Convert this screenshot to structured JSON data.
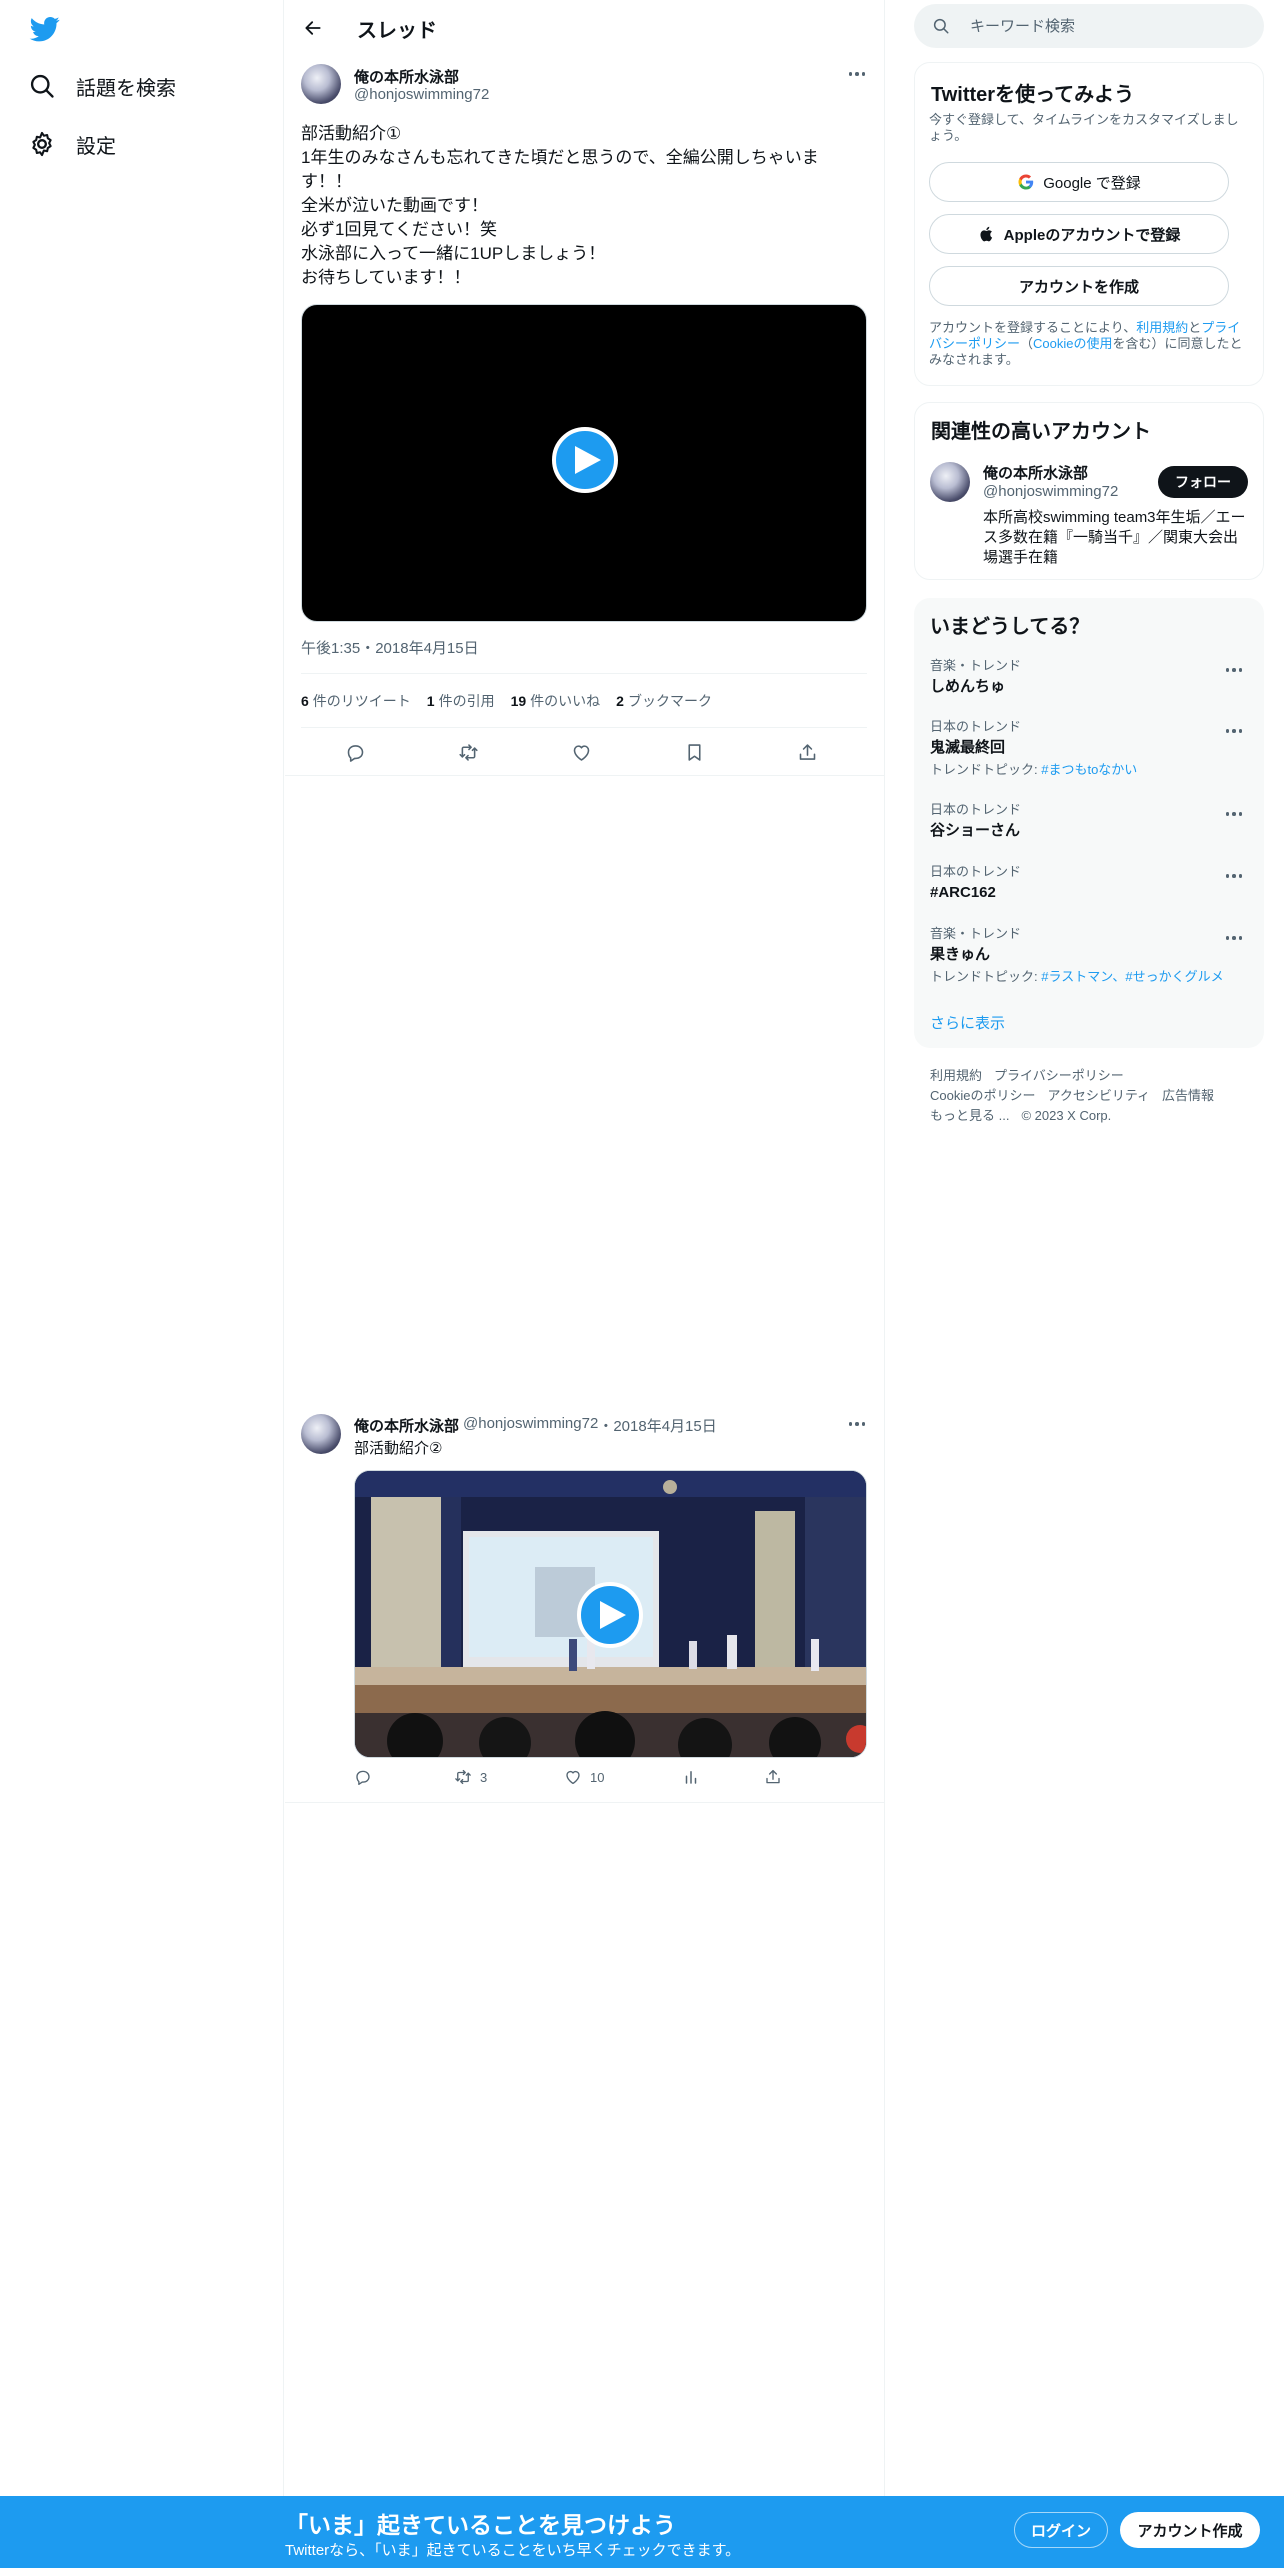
{
  "nav": {
    "explore_label": "話題を検索",
    "settings_label": "設定"
  },
  "header": {
    "title": "スレッド"
  },
  "tweet": {
    "author_name": "俺の本所水泳部",
    "author_handle": "@honjoswimming72",
    "text_lines": [
      "部活動紹介①",
      "1年生のみなさんも忘れてきた頃だと思うので、全編公開しちゃいま",
      "す！！",
      "全米が泣いた動画です！",
      "必ず1回見てください！笑",
      "水泳部に入って一緒に1UPしましょう！",
      "お待ちしています！！"
    ],
    "time": "午後1:35・2018年4月15日",
    "stats": {
      "retweets_count": "6",
      "retweets_label": "件のリツイート",
      "quotes_count": "1",
      "quotes_label": "件の引用",
      "likes_count": "19",
      "likes_label": "件のいいね",
      "bookmarks_count": "2",
      "bookmarks_label": "ブックマーク"
    }
  },
  "reply": {
    "author_name": "俺の本所水泳部",
    "author_handle": "@honjoswimming72",
    "separator": "・",
    "date": "2018年4月15日",
    "text": "部活動紹介②",
    "retweets": "3",
    "likes": "10"
  },
  "search": {
    "placeholder": "キーワード検索"
  },
  "signup_card": {
    "title": "Twitterを使ってみよう",
    "subtitle": "今すぐ登録して、タイムラインをカスタマイズしましょう。",
    "google_label": "Google で登録",
    "apple_label": "Appleのアカウントで登録",
    "create_label": "アカウントを作成",
    "legal_prefix": "アカウントを登録することにより、",
    "legal_terms": "利用規約",
    "legal_and": "と",
    "legal_privacy": "プライバシーポリシー",
    "legal_open": "（",
    "legal_cookie": "Cookieの使用",
    "legal_suffix": "を含む）に同意したとみなされます。"
  },
  "related": {
    "title": "関連性の高いアカウント",
    "name": "俺の本所水泳部",
    "handle": "@honjoswimming72",
    "follow_label": "フォロー",
    "bio": "本所高校swimming team3年生垢／エース多数在籍『一騎当千』／関東大会出場選手在籍"
  },
  "trends": {
    "title": "いまどうしてる？",
    "items": [
      {
        "category": "音楽・トレンド",
        "name": "しめんちゅ",
        "topic_label": "",
        "topics": ""
      },
      {
        "category": "日本のトレンド",
        "name": "鬼滅最終回",
        "topic_label": "トレンドトピック: ",
        "topics": "#まつもtoなかい"
      },
      {
        "category": "日本のトレンド",
        "name": "谷ショーさん",
        "topic_label": "",
        "topics": ""
      },
      {
        "category": "日本のトレンド",
        "name": "#ARC162",
        "topic_label": "",
        "topics": ""
      },
      {
        "category": "音楽・トレンド",
        "name": "果きゅん",
        "topic_label": "トレンドトピック: ",
        "topics": "#ラストマン、#せっかくグルメ"
      }
    ],
    "show_more": "さらに表示"
  },
  "footer": {
    "terms": "利用規約",
    "privacy": "プライバシーポリシー",
    "cookie": "Cookieのポリシー",
    "accessibility": "アクセシビリティ",
    "ads": "広告情報",
    "more": "もっと見る ...",
    "copyright": "© 2023 X Corp."
  },
  "banner": {
    "title": "「いま」起きていることを見つけよう",
    "subtitle": "Twitterなら、「いま」起きていることをいち早くチェックできます。",
    "login_label": "ログイン",
    "signup_label": "アカウント作成"
  },
  "colors": {
    "accent": "#1d9bf0",
    "text": "#0f1419",
    "muted": "#536471",
    "border": "#eff3f4"
  }
}
